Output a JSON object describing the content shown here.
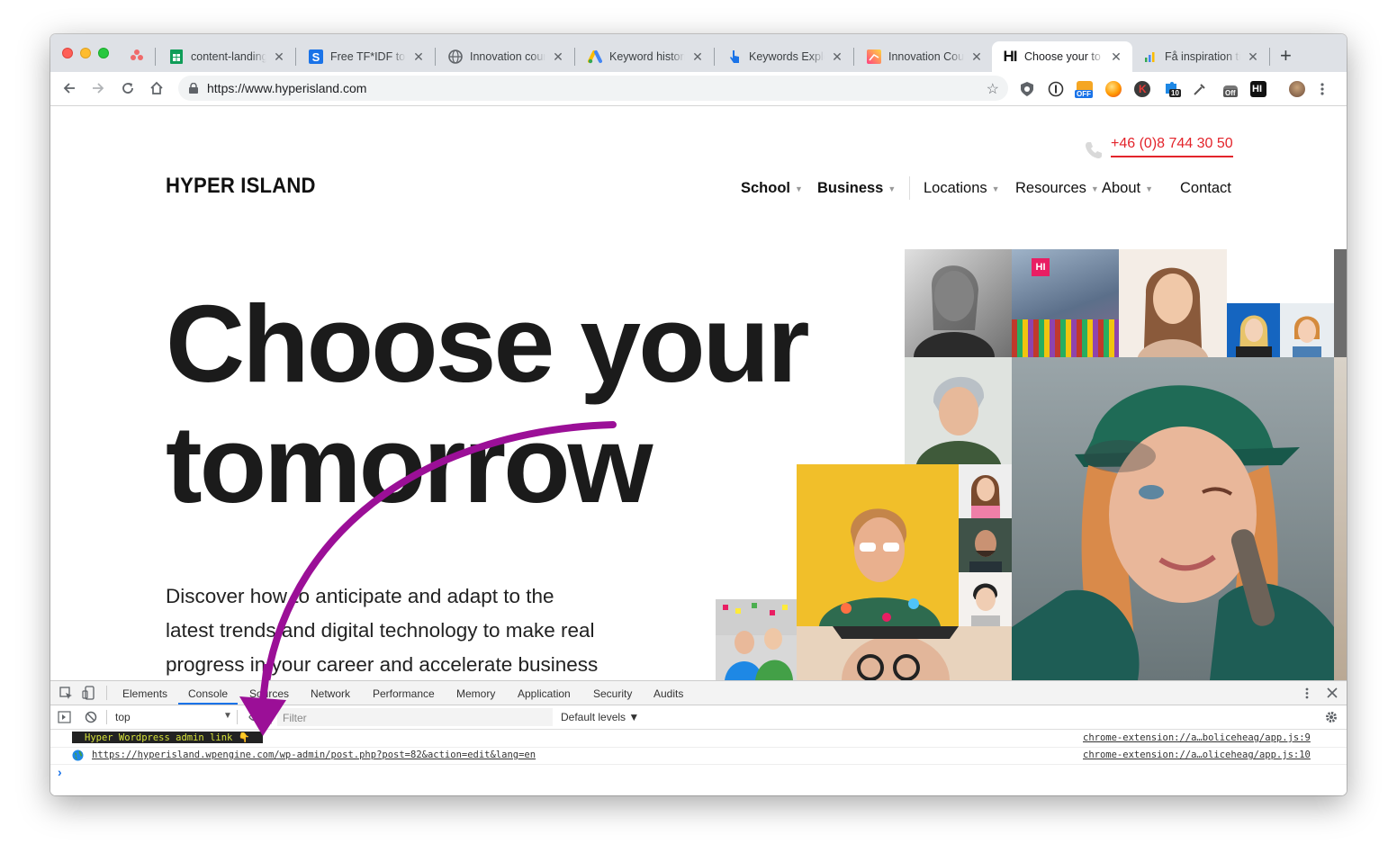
{
  "browser": {
    "tabs": [
      {
        "title": "content-landing",
        "favicon": "sheets-icon",
        "color": "#0f9d58"
      },
      {
        "title": "Free TF*IDF tool",
        "favicon": "s-icon",
        "color": "#1a73e8"
      },
      {
        "title": "Innovation cours",
        "favicon": "globe-icon",
        "color": "#5f6368"
      },
      {
        "title": "Keyword historic",
        "favicon": "google-ads-icon",
        "color": "#fbbc04"
      },
      {
        "title": "Keywords Explor",
        "favicon": "pointer-icon",
        "color": "#1a73e8"
      },
      {
        "title": "Innovation Cour",
        "favicon": "gradient-icon",
        "color": "#e040fb"
      },
      {
        "title": "Choose your to",
        "favicon": "hi-icon",
        "color": "#111111"
      },
      {
        "title": "Få inspiration til",
        "favicon": "chart-icon",
        "color": "#34a853"
      }
    ],
    "active_tab_index": 6,
    "url": "https://www.hyperisland.com",
    "ext_badges": {
      "off1": "OFF",
      "ten": "10",
      "off2": "Off",
      "hi": "HI"
    }
  },
  "site": {
    "phone": "+46 (0)8 744 30 50",
    "logo": "HYPER ISLAND",
    "nav": {
      "school": "School",
      "business": "Business",
      "locations": "Locations",
      "resources": "Resources",
      "about": "About",
      "contact": "Contact"
    },
    "hero_line1": "Choose your",
    "hero_line2": "tomorrow",
    "lead_line1": "Discover how to anticipate and adapt to the",
    "lead_line2": "latest trends and digital technology to make real",
    "lead_line3": "progress in your career and accelerate business",
    "accent": "#e3242b",
    "annotation_color": "#9b0f97",
    "photo_badge": "HI"
  },
  "devtools": {
    "tabs": [
      "Elements",
      "Console",
      "Sources",
      "Network",
      "Performance",
      "Memory",
      "Application",
      "Security",
      "Audits"
    ],
    "active_tab": "Console",
    "context": "top",
    "filter_placeholder": "Filter",
    "levels": "Default levels ▼",
    "log1": "Hyper Wordpress admin link 👇",
    "log1_source": "chrome-extension://a…boliceheag/app.js:9",
    "log2": "https://hyperisland.wpengine.com/wp-admin/post.php?post=82&action=edit&lang=en",
    "log2_source": "chrome-extension://a…oliceheag/app.js:10",
    "prompt": "›"
  }
}
